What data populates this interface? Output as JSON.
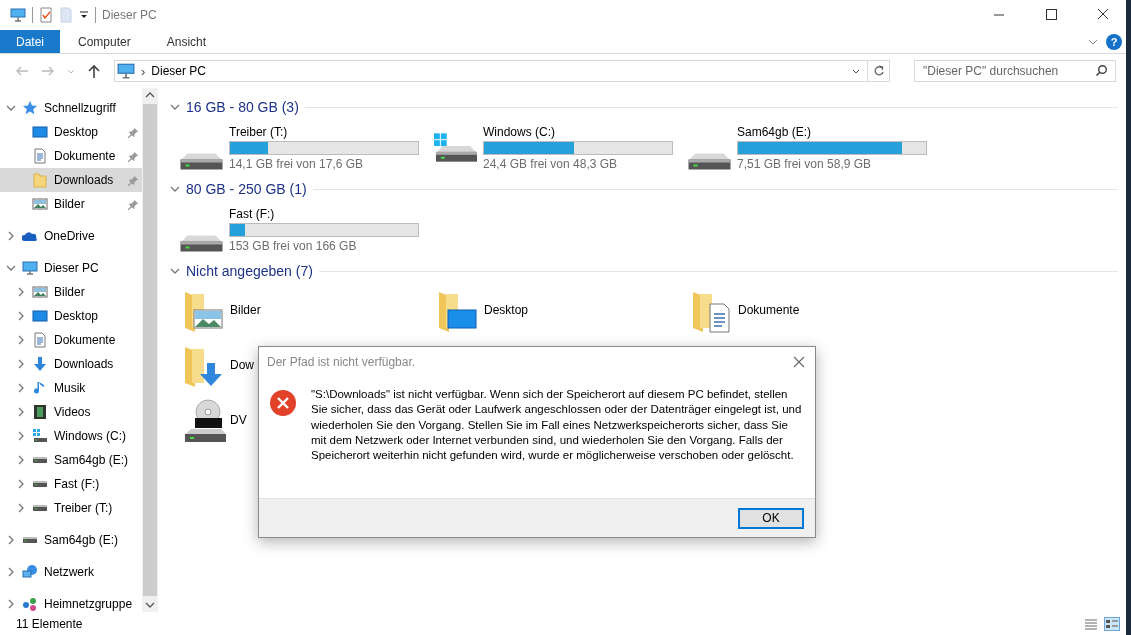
{
  "window": {
    "title": "Dieser PC"
  },
  "ribbon": {
    "tabs": [
      {
        "label": "Datei",
        "selected": true
      },
      {
        "label": "Computer",
        "selected": false
      },
      {
        "label": "Ansicht",
        "selected": false
      }
    ],
    "help": "?"
  },
  "address": {
    "path": "Dieser PC",
    "separator": "›",
    "search": {
      "placeholder": "\"Dieser PC\" durchsuchen"
    }
  },
  "sidebar": {
    "items": [
      {
        "label": "Schnellzugriff",
        "kind": "star",
        "expanded": true,
        "selected": false,
        "children": [
          {
            "label": "Desktop",
            "kind": "desktop",
            "pinned": true,
            "selected": false
          },
          {
            "label": "Dokumente",
            "kind": "document",
            "pinned": true,
            "selected": false
          },
          {
            "label": "Downloads",
            "kind": "folder",
            "pinned": true,
            "selected": true
          },
          {
            "label": "Bilder",
            "kind": "pictures",
            "pinned": true,
            "selected": false
          }
        ]
      },
      {
        "label": "OneDrive",
        "kind": "cloud",
        "expanded": false,
        "selected": false
      },
      {
        "label": "Dieser PC",
        "kind": "pc",
        "expanded": true,
        "selected": false,
        "children": [
          {
            "label": "Bilder",
            "kind": "pictures",
            "expanded": false,
            "selected": false
          },
          {
            "label": "Desktop",
            "kind": "desktop",
            "expanded": false,
            "selected": false
          },
          {
            "label": "Dokumente",
            "kind": "document",
            "expanded": false,
            "selected": false
          },
          {
            "label": "Downloads",
            "kind": "download",
            "expanded": false,
            "selected": false
          },
          {
            "label": "Musik",
            "kind": "music",
            "expanded": false,
            "selected": false
          },
          {
            "label": "Videos",
            "kind": "video",
            "expanded": false,
            "selected": false
          },
          {
            "label": "Windows (C:)",
            "kind": "windrive",
            "expanded": false,
            "selected": false
          },
          {
            "label": "Sam64gb (E:)",
            "kind": "drive",
            "expanded": false,
            "selected": false
          },
          {
            "label": "Fast (F:)",
            "kind": "drive",
            "expanded": false,
            "selected": false
          },
          {
            "label": "Treiber (T:)",
            "kind": "drive",
            "expanded": false,
            "selected": false
          }
        ]
      },
      {
        "label": "Sam64gb (E:)",
        "kind": "drive",
        "expanded": false,
        "selected": false
      },
      {
        "label": "Netzwerk",
        "kind": "network",
        "expanded": false,
        "selected": false
      },
      {
        "label": "Heimnetzgruppe",
        "kind": "homegroup",
        "expanded": false,
        "selected": false
      }
    ]
  },
  "groups": [
    {
      "heading": "16 GB - 80 GB (3)",
      "expanded": true,
      "items": [
        {
          "kind": "drive",
          "name": "Treiber (T:)",
          "free": "14,1 GB frei von 17,6 GB",
          "level": 0.2
        },
        {
          "kind": "windrive",
          "name": "Windows (C:)",
          "free": "24,4 GB frei von 48,3 GB",
          "level": 0.48
        },
        {
          "kind": "drive",
          "name": "Sam64gb (E:)",
          "free": "7,51 GB frei von 58,9 GB",
          "level": 0.87
        }
      ]
    },
    {
      "heading": "80 GB - 250 GB (1)",
      "expanded": true,
      "items": [
        {
          "kind": "drive",
          "name": "Fast (F:)",
          "free": "153 GB frei von 166 GB",
          "level": 0.08
        }
      ]
    },
    {
      "heading": "Nicht angegeben (7)",
      "expanded": true,
      "items": [
        {
          "kind": "pictures",
          "name": "Bilder"
        },
        {
          "kind": "desktop",
          "name": "Desktop"
        },
        {
          "kind": "documents",
          "name": "Dokumente"
        },
        {
          "kind": "downloads",
          "name": "Dow"
        },
        {
          "kind": "dvd",
          "name": "DV"
        }
      ]
    }
  ],
  "dialog": {
    "title": "Der Pfad ist nicht verfügbar.",
    "message": "\"S:\\Downloads\" ist nicht verfügbar. Wenn sich der Speicherort auf diesem PC befindet, stellen Sie sicher, dass das Gerät oder Laufwerk angeschlossen oder der Datenträger eingelegt ist, und wiederholen Sie den Vorgang. Stellen Sie im Fall eines Netzwerkspeicherorts sicher, dass Sie mit dem Netzwerk oder Internet verbunden sind, und wiederholen Sie den Vorgang. Falls der Speicherort weiterhin nicht gefunden wird, wurde er möglicherweise verschoben oder gelöscht.",
    "button": "OK"
  },
  "status_bar": {
    "count": "11 Elemente"
  }
}
